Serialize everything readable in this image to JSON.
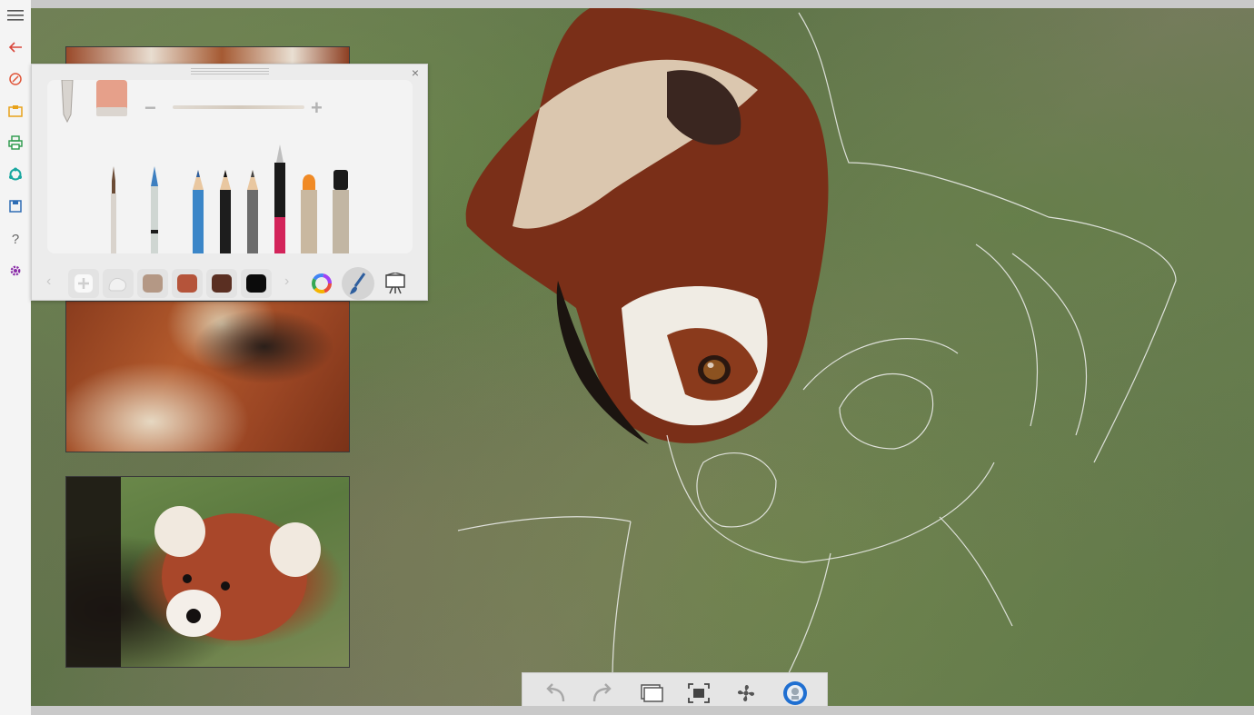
{
  "rail": {
    "items": [
      {
        "icon": "menu-icon"
      },
      {
        "icon": "back-arrow-icon"
      },
      {
        "icon": "brush-mode-icon"
      },
      {
        "icon": "open-folder-icon"
      },
      {
        "icon": "print-icon"
      },
      {
        "icon": "share-icon"
      },
      {
        "icon": "save-icon"
      },
      {
        "icon": "help-icon",
        "label": "?"
      },
      {
        "icon": "settings-icon"
      }
    ]
  },
  "panel": {
    "close_label": "×",
    "size_minus": "−",
    "size_plus": "+",
    "tools": [
      {
        "name": "fine-brush"
      },
      {
        "name": "fan-brush"
      },
      {
        "name": "blue-pencil"
      },
      {
        "name": "black-pencil"
      },
      {
        "name": "gray-pencil"
      },
      {
        "name": "fountain-pen"
      },
      {
        "name": "orange-marker"
      },
      {
        "name": "black-marker"
      }
    ],
    "swatches": [
      {
        "color": "#ffffff",
        "kind": "add"
      },
      {
        "color": "#d9d5d0",
        "kind": "smudge"
      },
      {
        "color": "#b49885"
      },
      {
        "color": "#b5543a"
      },
      {
        "color": "#5a2f22"
      },
      {
        "color": "#0b0b0b"
      }
    ],
    "nav_prev": "‹",
    "nav_next": "›",
    "accent_colors": [
      "#e94e3c",
      "#f4b400",
      "#34a853",
      "#4285f4",
      "#a142f4"
    ]
  },
  "bottombar": {
    "items": [
      {
        "icon": "undo-icon"
      },
      {
        "icon": "redo-icon"
      },
      {
        "icon": "layers-icon"
      },
      {
        "icon": "fit-screen-icon"
      },
      {
        "icon": "fan-icon"
      },
      {
        "icon": "tracing-globe-icon"
      }
    ]
  }
}
